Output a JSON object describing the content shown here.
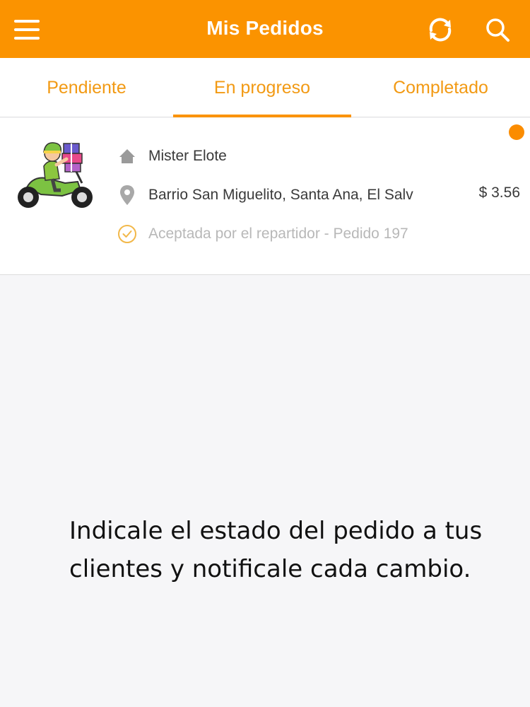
{
  "header": {
    "title": "Mis Pedidos",
    "menu_icon": "hamburger-menu-icon",
    "refresh_icon": "refresh-icon",
    "search_icon": "search-icon",
    "background_color": "#fb9300"
  },
  "tabs": [
    {
      "label": "Pendiente",
      "active": false
    },
    {
      "label": "En progreso",
      "active": true
    },
    {
      "label": "Completado",
      "active": false
    }
  ],
  "order": {
    "image": "delivery-courier-scooter-illustration",
    "restaurant": "Mister Elote",
    "address": "Barrio San Miguelito, Santa Ana, El Salv",
    "price": "$ 3.56",
    "status": "Aceptada por el repartidor - Pedido 197",
    "unread": true
  },
  "caption": "Indicale el estado del pedido a tus clientes y notificale cada cambio.",
  "colors": {
    "accent": "#fb9300",
    "tab_text": "#f29a14",
    "muted_text": "#b8b8b8",
    "background": "#f6f6f8"
  }
}
